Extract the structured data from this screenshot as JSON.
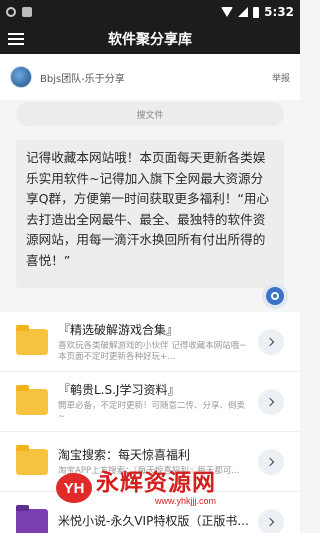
{
  "status_bar": {
    "time": "5:32",
    "icons": [
      "settings-icon",
      "notification-icon",
      "wifi-icon",
      "signal-icon",
      "battery-icon"
    ]
  },
  "app_bar": {
    "title": "软件聚分享库",
    "menu_icon": "hamburger-menu-icon"
  },
  "author": {
    "name": "Bbjs团队-乐于分享",
    "report_label": "举报"
  },
  "search": {
    "placeholder": "搜文件"
  },
  "announcement": {
    "text": "记得收藏本网站哦！本页面每天更新各类娱乐实用软件~记得加入旗下全网最大资源分享Q群，方便第一时间获取更多福利！“用心去打造出全网最牛、最全、最独特的软件资源网站，用每一滴汗水换回所有付出所得的喜悦！”"
  },
  "items": [
    {
      "title": "『精选破解游戏合集』",
      "desc": "喜欢玩各类破解游戏的小伙伴 记得收藏本网站哦~本页面不定时更新各种好玩+..."
    },
    {
      "title": "『鹌贵L.S.J学习资料』",
      "desc": "開車必备，不定时更新！可随意二传、分享、倒卖~"
    },
    {
      "title": "淘宝搜索：每天惊喜福利",
      "desc": "淘宝APP上方搜索：『每天惊喜福利』每天都可..."
    },
    {
      "title": "米悦小说-永久VIP特权版（正版书...",
      "desc": ""
    }
  ],
  "watermark": {
    "logo_text": "YH",
    "text": "永辉资源网",
    "url": "www.yhkjjj.com"
  },
  "colors": {
    "bar_bg": "#1c1c1c",
    "folder": "#f7c33f",
    "accent": "#3a73c9",
    "watermark": "#d41f1f"
  }
}
